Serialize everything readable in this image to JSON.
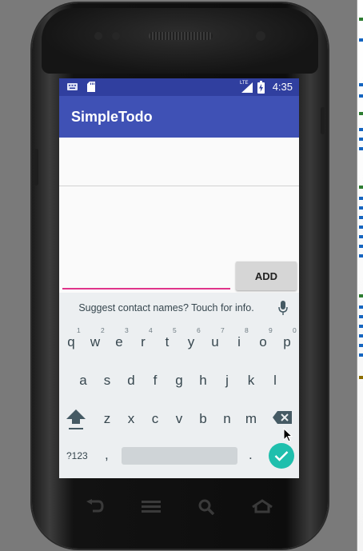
{
  "status_bar": {
    "time": "4:35",
    "network_label": "LTE",
    "icons": [
      "keyboard-icon",
      "sd-card-icon",
      "signal-icon",
      "battery-charging-icon"
    ]
  },
  "app_bar": {
    "title": "SimpleTodo"
  },
  "todo": {
    "items": [
      ""
    ],
    "input_value": "",
    "add_label": "ADD"
  },
  "keyboard": {
    "suggestion": "Suggest contact names? Touch for info.",
    "row1": [
      "q",
      "w",
      "e",
      "r",
      "t",
      "y",
      "u",
      "i",
      "o",
      "p"
    ],
    "row1_hints": [
      "1",
      "2",
      "3",
      "4",
      "5",
      "6",
      "7",
      "8",
      "9",
      "0"
    ],
    "row2": [
      "a",
      "s",
      "d",
      "f",
      "g",
      "h",
      "j",
      "k",
      "l"
    ],
    "row3": [
      "z",
      "x",
      "c",
      "v",
      "b",
      "n",
      "m"
    ],
    "symbols_label": "?123",
    "comma": ",",
    "period": "."
  },
  "colors": {
    "status_bar": "#303f9f",
    "app_bar": "#3f51b5",
    "input_underline": "#e0348a",
    "enter_key": "#1fbfad",
    "keyboard_bg": "#eceff1"
  }
}
